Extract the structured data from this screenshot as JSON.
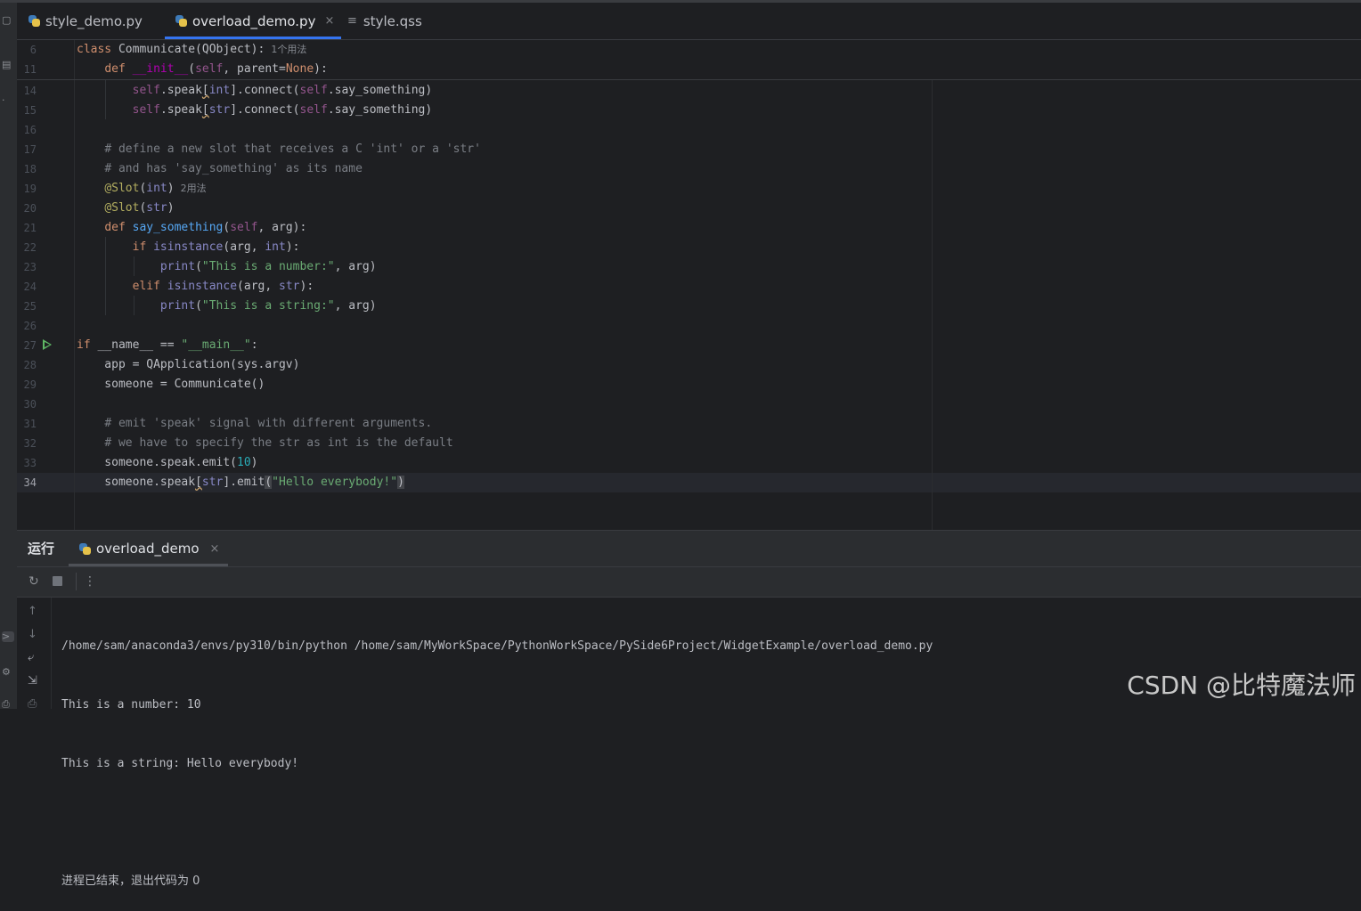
{
  "tabs": [
    {
      "label": "style_demo.py",
      "icon": "python-file-icon"
    },
    {
      "label": "overload_demo.py",
      "icon": "python-file-icon",
      "close": "×"
    },
    {
      "label": "style.qss",
      "icon": "text-file-icon"
    }
  ],
  "sticky": [
    {
      "ln": "6",
      "parts": [
        [
          "kw",
          "class "
        ],
        [
          "",
          "Communicate(QObject):"
        ],
        [
          "hint",
          "  1个用法"
        ]
      ]
    },
    {
      "ln": "11",
      "parts": [
        [
          "",
          "    "
        ],
        [
          "kw",
          "def "
        ],
        [
          "dunder",
          "__init__"
        ],
        [
          "",
          "("
        ],
        [
          "self",
          "self"
        ],
        [
          "",
          ", parent="
        ],
        [
          "kw",
          "None"
        ],
        [
          "",
          "):"
        ]
      ]
    }
  ],
  "lines": [
    {
      "ln": "14",
      "parts": [
        [
          "",
          "        "
        ],
        [
          "self",
          "self"
        ],
        [
          "",
          ".speak"
        ],
        [
          "squig",
          "["
        ],
        [
          "bi",
          "int"
        ],
        [
          "",
          "].connect("
        ],
        [
          "self",
          "self"
        ],
        [
          "",
          ".say_something)"
        ]
      ]
    },
    {
      "ln": "15",
      "parts": [
        [
          "",
          "        "
        ],
        [
          "self",
          "self"
        ],
        [
          "",
          ".speak"
        ],
        [
          "squig",
          "["
        ],
        [
          "bi",
          "str"
        ],
        [
          "",
          "].connect("
        ],
        [
          "self",
          "self"
        ],
        [
          "",
          ".say_something)"
        ]
      ]
    },
    {
      "ln": "16",
      "parts": []
    },
    {
      "ln": "17",
      "parts": [
        [
          "",
          "    "
        ],
        [
          "cmt",
          "# define a new slot that receives a C 'int' or a 'str'"
        ]
      ]
    },
    {
      "ln": "18",
      "parts": [
        [
          "",
          "    "
        ],
        [
          "cmt",
          "# and has 'say_something' as its name"
        ]
      ]
    },
    {
      "ln": "19",
      "parts": [
        [
          "",
          "    "
        ],
        [
          "dec",
          "@Slot"
        ],
        [
          "",
          "("
        ],
        [
          "bi",
          "int"
        ],
        [
          "",
          ")"
        ],
        [
          "hint",
          "  2用法"
        ]
      ]
    },
    {
      "ln": "20",
      "parts": [
        [
          "",
          "    "
        ],
        [
          "dec",
          "@Slot"
        ],
        [
          "",
          "("
        ],
        [
          "bi",
          "str"
        ],
        [
          "",
          ")"
        ]
      ]
    },
    {
      "ln": "21",
      "parts": [
        [
          "",
          "    "
        ],
        [
          "kw",
          "def "
        ],
        [
          "fn",
          "say_something"
        ],
        [
          "",
          "("
        ],
        [
          "self",
          "self"
        ],
        [
          "",
          ", arg):"
        ]
      ]
    },
    {
      "ln": "22",
      "parts": [
        [
          "",
          "        "
        ],
        [
          "kw",
          "if "
        ],
        [
          "bi",
          "isinstance"
        ],
        [
          "",
          "(arg, "
        ],
        [
          "bi",
          "int"
        ],
        [
          "",
          "):"
        ]
      ]
    },
    {
      "ln": "23",
      "parts": [
        [
          "",
          "            "
        ],
        [
          "bi",
          "print"
        ],
        [
          "",
          "("
        ],
        [
          "str",
          "\"This is a number:\""
        ],
        [
          "",
          ", arg)"
        ]
      ]
    },
    {
      "ln": "24",
      "parts": [
        [
          "",
          "        "
        ],
        [
          "kw",
          "elif "
        ],
        [
          "bi",
          "isinstance"
        ],
        [
          "",
          "(arg, "
        ],
        [
          "bi",
          "str"
        ],
        [
          "",
          "):"
        ]
      ]
    },
    {
      "ln": "25",
      "parts": [
        [
          "",
          "            "
        ],
        [
          "bi",
          "print"
        ],
        [
          "",
          "("
        ],
        [
          "str",
          "\"This is a string:\""
        ],
        [
          "",
          ", arg)"
        ]
      ]
    },
    {
      "ln": "26",
      "parts": []
    },
    {
      "ln": "27",
      "run": true,
      "parts": [
        [
          "kw",
          "if "
        ],
        [
          "",
          "__name__ == "
        ],
        [
          "str",
          "\"__main__\""
        ],
        [
          "",
          ":"
        ]
      ]
    },
    {
      "ln": "28",
      "parts": [
        [
          "",
          "    app = QApplication(sys.argv)"
        ]
      ]
    },
    {
      "ln": "29",
      "parts": [
        [
          "",
          "    someone = Communicate()"
        ]
      ]
    },
    {
      "ln": "30",
      "parts": []
    },
    {
      "ln": "31",
      "parts": [
        [
          "",
          "    "
        ],
        [
          "cmt",
          "# emit 'speak' signal with different arguments."
        ]
      ]
    },
    {
      "ln": "32",
      "parts": [
        [
          "",
          "    "
        ],
        [
          "cmt",
          "# we have to specify the str as int is the default"
        ]
      ]
    },
    {
      "ln": "33",
      "parts": [
        [
          "",
          "    someone.speak.emit("
        ],
        [
          "num",
          "10"
        ],
        [
          "",
          ")"
        ]
      ]
    },
    {
      "ln": "34",
      "current": true,
      "parts": [
        [
          "",
          "    someone.speak"
        ],
        [
          "squig",
          "["
        ],
        [
          "bi",
          "str"
        ],
        [
          "",
          "].emit"
        ],
        [
          "bracket",
          "("
        ],
        [
          "str",
          "\"Hello everybody!\""
        ],
        [
          "bracket",
          ")"
        ]
      ]
    }
  ],
  "run_panel": {
    "title": "运行",
    "tab_label": "overload_demo",
    "close": "×"
  },
  "console": [
    "/home/sam/anaconda3/envs/py310/bin/python /home/sam/MyWorkSpace/PythonWorkSpace/PySide6Project/WidgetExample/overload_demo.py",
    "This is a number: 10",
    "This is a string: Hello everybody!",
    "",
    "进程已结束，退出代码为 0"
  ],
  "watermark": "CSDN @比特魔法师"
}
